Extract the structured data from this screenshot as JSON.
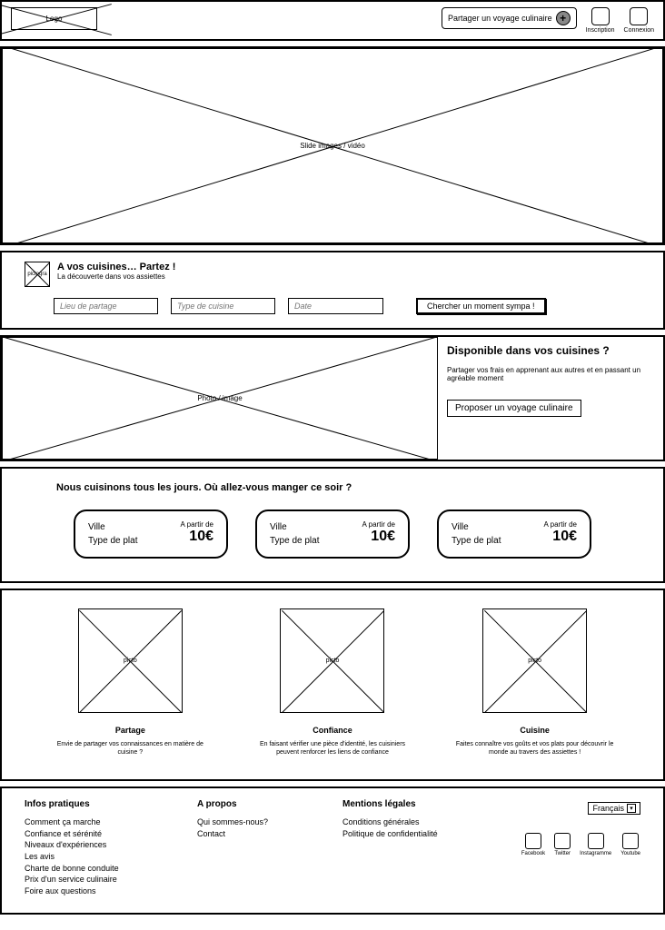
{
  "header": {
    "logo_label": "Logo",
    "share_label": "Partager un voyage culinaire",
    "signup_label": "Inscription",
    "login_label": "Connexion"
  },
  "hero": {
    "placeholder": "Slide images / vidéo"
  },
  "search": {
    "picto": "pictogra",
    "title": "A vos cuisines… Partez !",
    "subtitle": "La découverte dans vos assiettes",
    "field_place": "Lieu de partage",
    "field_cuisine": "Type de cuisine",
    "field_date": "Date",
    "button": "Chercher un moment sympa !"
  },
  "promo": {
    "img_label": "Photo / image",
    "title": "Disponible dans vos cuisines ?",
    "text": "Partager vos frais en apprenant aux autres et en passant un agréable moment",
    "button": "Proposer un voyage culinaire"
  },
  "offers": {
    "heading": "Nous cuisinons tous les jours. Où allez-vous manger ce soir ?",
    "cards": [
      {
        "city": "Ville",
        "type": "Type de plat",
        "from": "A partir de",
        "price": "10€"
      },
      {
        "city": "Ville",
        "type": "Type de plat",
        "from": "A partir de",
        "price": "10€"
      },
      {
        "city": "Ville",
        "type": "Type de plat",
        "from": "A partir de",
        "price": "10€"
      }
    ]
  },
  "values": {
    "items": [
      {
        "picto": "picto",
        "title": "Partage",
        "text": "Envie de partager vos connaissances en matière de cuisine ?"
      },
      {
        "picto": "picto",
        "title": "Confiance",
        "text": "En faisant vérifier une pièce d'identité, les cuisiniers peuvent renforcer les liens de confiance"
      },
      {
        "picto": "picto",
        "title": "Cuisine",
        "text": "Faites connaître vos goûts et vos plats pour découvrir le monde au travers des assiettes !"
      }
    ]
  },
  "footer": {
    "col1": {
      "title": "Infos pratiques",
      "links": [
        "Comment ça marche",
        "Confiance et sérénité",
        "Niveaux d'expériences",
        "Les avis",
        "Charte de bonne conduite",
        "Prix d'un service culinaire",
        "Foire aux questions"
      ]
    },
    "col2": {
      "title": "A propos",
      "links": [
        "Qui sommes-nous?",
        "Contact"
      ]
    },
    "col3": {
      "title": "Mentions légales",
      "links": [
        "Conditions générales",
        "Politique de confidentialité"
      ]
    },
    "language": "Français",
    "socials": [
      "Facebook",
      "Twitter",
      "Instagramme",
      "Youtube"
    ]
  }
}
